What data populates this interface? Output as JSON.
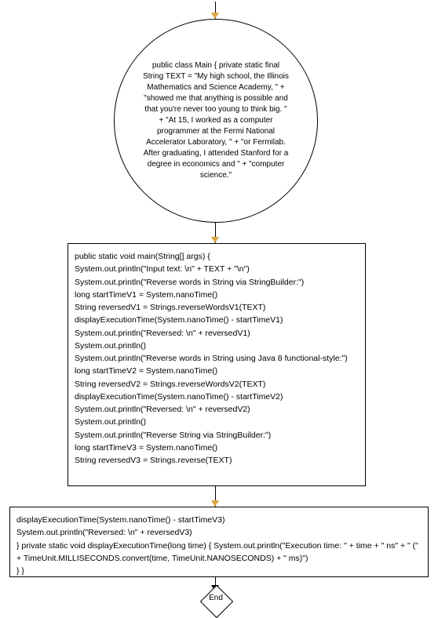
{
  "flowchart": {
    "nodes": {
      "start_circle": {
        "text": "public class Main {       private static final String TEXT = \"My high school, the Illinois Mathematics and Science Academy, \"             + \"showed me that anything is possible and that you're never too young to think big. \"             + \"At 15, I worked as a computer programmer at the Fermi National Accelerator Laboratory, \"             + \"or Fermilab. After graduating, I attended Stanford for a degree in economics and \"             + \"computer science.\""
      },
      "rect1": {
        "lines": [
          "public static void main(String[] args) {",
          "System.out.println(\"Input text: \\n\" + TEXT + \"\\n\")",
          "System.out.println(\"Reverse words in String via StringBuilder:\")",
          "long startTimeV1 = System.nanoTime()",
          "String reversedV1 = Strings.reverseWordsV1(TEXT)",
          "displayExecutionTime(System.nanoTime() - startTimeV1)",
          "System.out.println(\"Reversed: \\n\" + reversedV1)",
          "System.out.println()",
          "System.out.println(\"Reverse words in String using Java 8 functional-style:\")",
          "long startTimeV2 = System.nanoTime()",
          "String reversedV2 = Strings.reverseWordsV2(TEXT)",
          "displayExecutionTime(System.nanoTime() - startTimeV2)",
          "System.out.println(\"Reversed: \\n\" + reversedV2)",
          "System.out.println()",
          "System.out.println(\"Reverse String via StringBuilder:\")",
          "long startTimeV3 = System.nanoTime()",
          "String reversedV3 = Strings.reverse(TEXT)"
        ]
      },
      "rect2": {
        "lines": [
          "displayExecutionTime(System.nanoTime() - startTimeV3)",
          "System.out.println(\"Reversed: \\n\" + reversedV3)",
          "}     private static void displayExecutionTime(long time) {         System.out.println(\"Execution time: \" + time + \" ns\" + \" (\"                 + TimeUnit.MILLISECONDS.convert(time, TimeUnit.NANOSECONDS) + \" ms)\")",
          "}  }"
        ]
      },
      "end": {
        "label": "End"
      }
    },
    "edges": [
      {
        "from": "entry",
        "to": "start_circle"
      },
      {
        "from": "start_circle",
        "to": "rect1"
      },
      {
        "from": "rect1",
        "to": "rect2"
      },
      {
        "from": "rect2",
        "to": "end"
      }
    ]
  }
}
